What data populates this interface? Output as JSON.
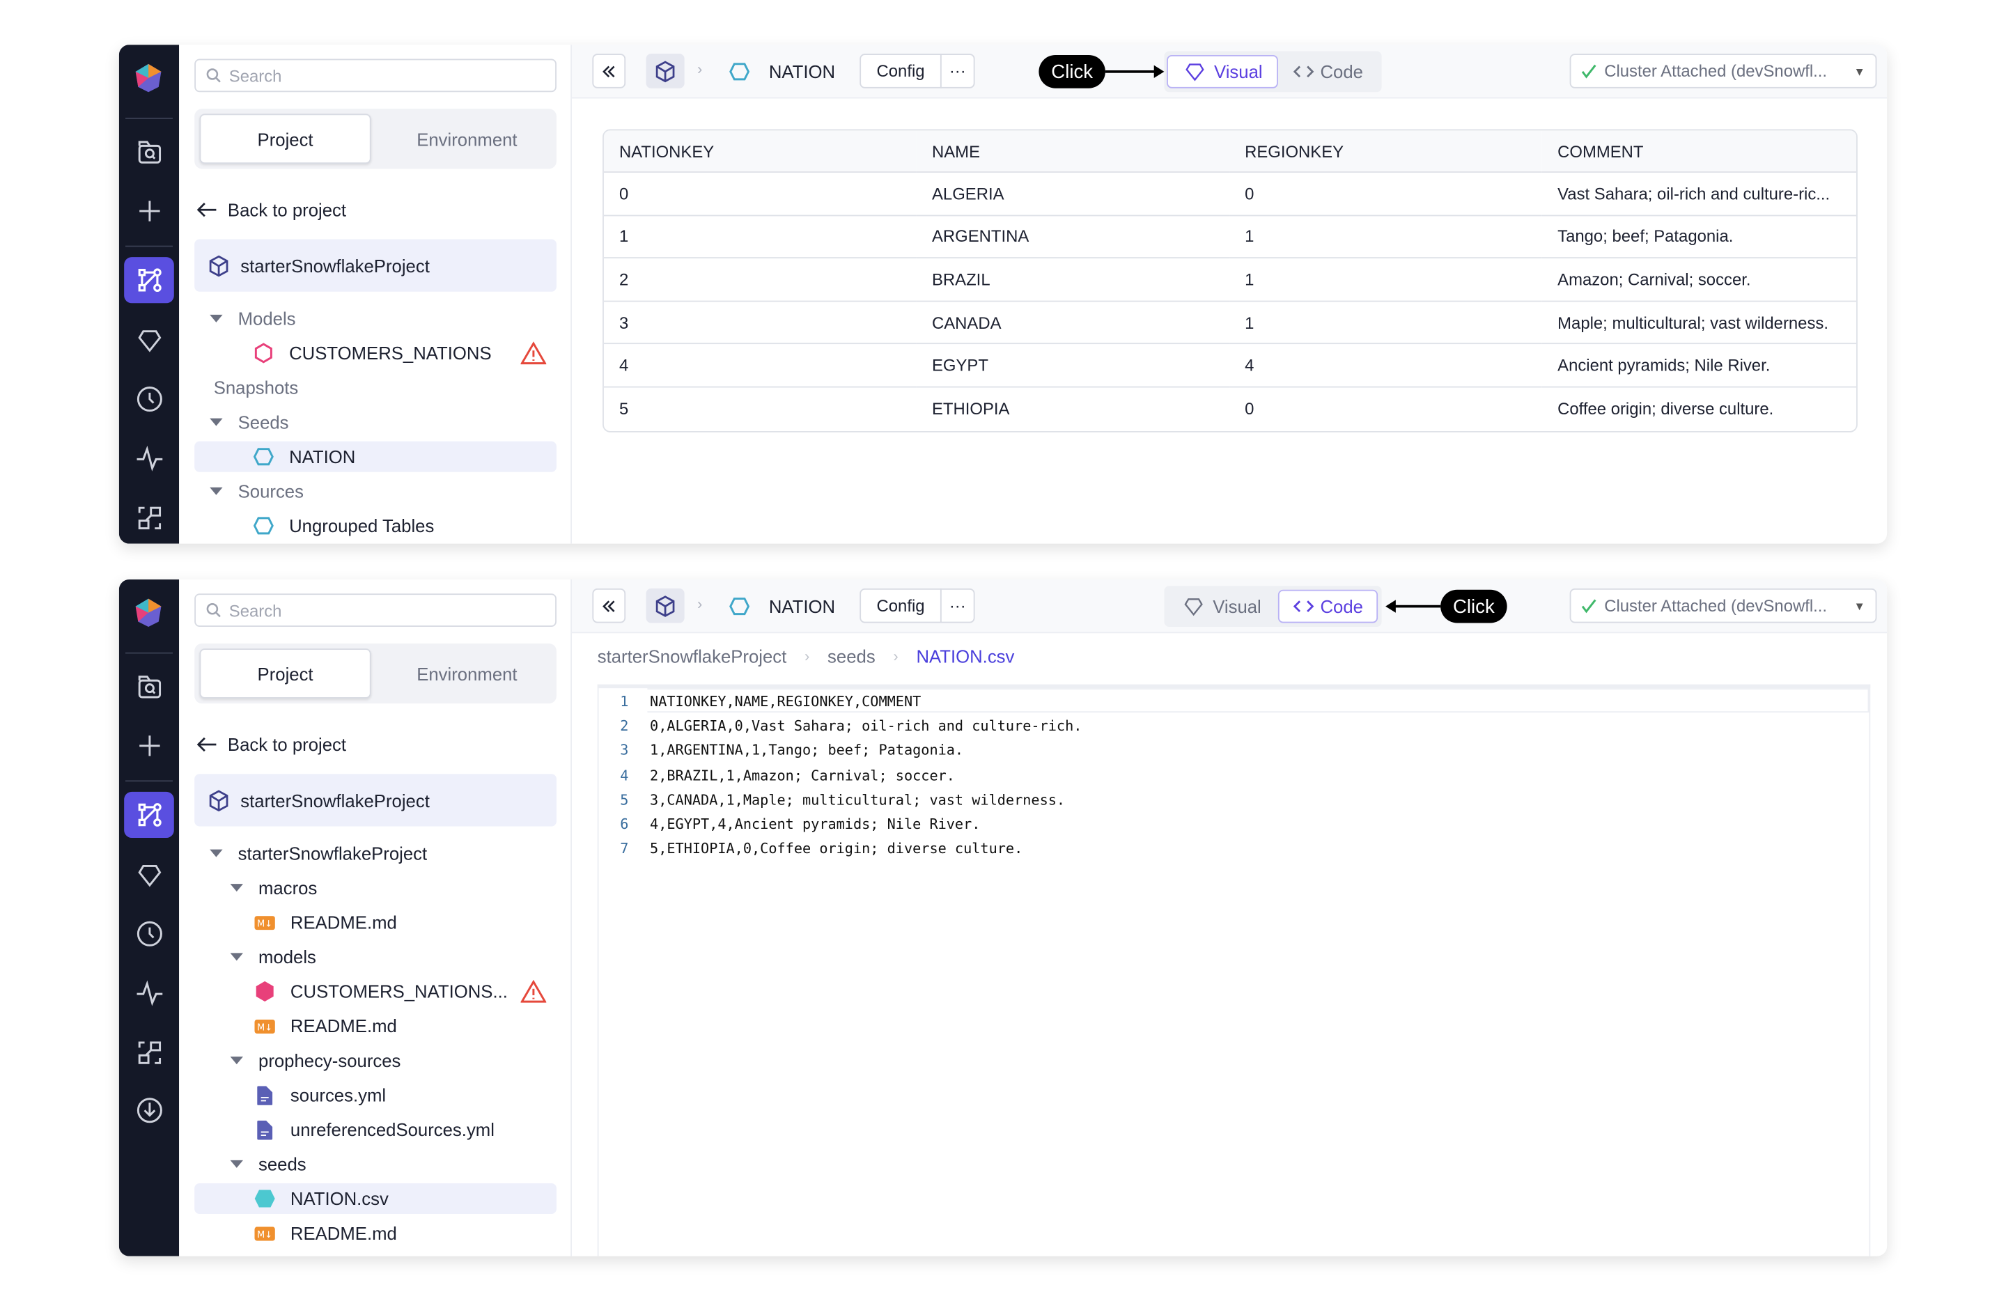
{
  "search": {
    "placeholder": "Search"
  },
  "tabs": {
    "project": "Project",
    "environment": "Environment"
  },
  "back_label": "Back to project",
  "project_name": "starterSnowflakeProject",
  "toolbar": {
    "title": "NATION",
    "config": "Config",
    "more": "···",
    "visual": "Visual",
    "code": "Code",
    "cluster": "Cluster Attached (devSnowfl...",
    "click_label": "Click"
  },
  "top": {
    "tree": [
      {
        "label": "Models",
        "type": "folder",
        "level": 0
      },
      {
        "label": "CUSTOMERS_NATIONS",
        "type": "model",
        "level": 1,
        "warning": true
      },
      {
        "label": "Snapshots",
        "type": "plain",
        "level": 0
      },
      {
        "label": "Seeds",
        "type": "folder",
        "level": 0
      },
      {
        "label": "NATION",
        "type": "seed",
        "level": 1,
        "selected": true
      },
      {
        "label": "Sources",
        "type": "folder",
        "level": 0
      },
      {
        "label": "Ungrouped Tables",
        "type": "seed",
        "level": 1
      }
    ],
    "table": {
      "columns": [
        "NATIONKEY",
        "NAME",
        "REGIONKEY",
        "COMMENT"
      ],
      "rows": [
        [
          "0",
          "ALGERIA",
          "0",
          "Vast Sahara; oil-rich and culture-ric..."
        ],
        [
          "1",
          "ARGENTINA",
          "1",
          "Tango; beef; Patagonia."
        ],
        [
          "2",
          "BRAZIL",
          "1",
          "Amazon; Carnival; soccer."
        ],
        [
          "3",
          "CANADA",
          "1",
          "Maple; multicultural; vast wilderness."
        ],
        [
          "4",
          "EGYPT",
          "4",
          "Ancient pyramids; Nile River."
        ],
        [
          "5",
          "ETHIOPIA",
          "0",
          "Coffee origin; diverse culture."
        ]
      ]
    }
  },
  "bottom": {
    "tree": [
      {
        "label": "starterSnowflakeProject",
        "type": "folder",
        "level": 0
      },
      {
        "label": "macros",
        "type": "folder",
        "level": 1
      },
      {
        "label": "README.md",
        "type": "md",
        "level": 2
      },
      {
        "label": "models",
        "type": "folder",
        "level": 1
      },
      {
        "label": "CUSTOMERS_NATIONS...",
        "type": "model-filled",
        "level": 2,
        "warning": true
      },
      {
        "label": "README.md",
        "type": "md",
        "level": 2
      },
      {
        "label": "prophecy-sources",
        "type": "folder",
        "level": 1
      },
      {
        "label": "sources.yml",
        "type": "file",
        "level": 2
      },
      {
        "label": "unreferencedSources.yml",
        "type": "file",
        "level": 2
      },
      {
        "label": "seeds",
        "type": "folder",
        "level": 1
      },
      {
        "label": "NATION.csv",
        "type": "seed-filled",
        "level": 2,
        "selected": true
      },
      {
        "label": "README.md",
        "type": "md",
        "level": 2
      }
    ],
    "breadcrumbs": [
      "starterSnowflakeProject",
      "seeds",
      "NATION.csv"
    ],
    "code_lines": [
      "NATIONKEY,NAME,REGIONKEY,COMMENT",
      "0,ALGERIA,0,Vast Sahara; oil-rich and culture-rich.",
      "1,ARGENTINA,1,Tango; beef; Patagonia.",
      "2,BRAZIL,1,Amazon; Carnival; soccer.",
      "3,CANADA,1,Maple; multicultural; vast wilderness.",
      "4,EGYPT,4,Ancient pyramids; Nile River.",
      "5,ETHIOPIA,0,Coffee origin; diverse culture."
    ]
  },
  "colors": {
    "accent": "#5a4fe0",
    "rail": "#141827",
    "warning": "#e5483b",
    "seed": "#3fa7c9",
    "model": "#e8407a",
    "md": "#f0902e"
  }
}
